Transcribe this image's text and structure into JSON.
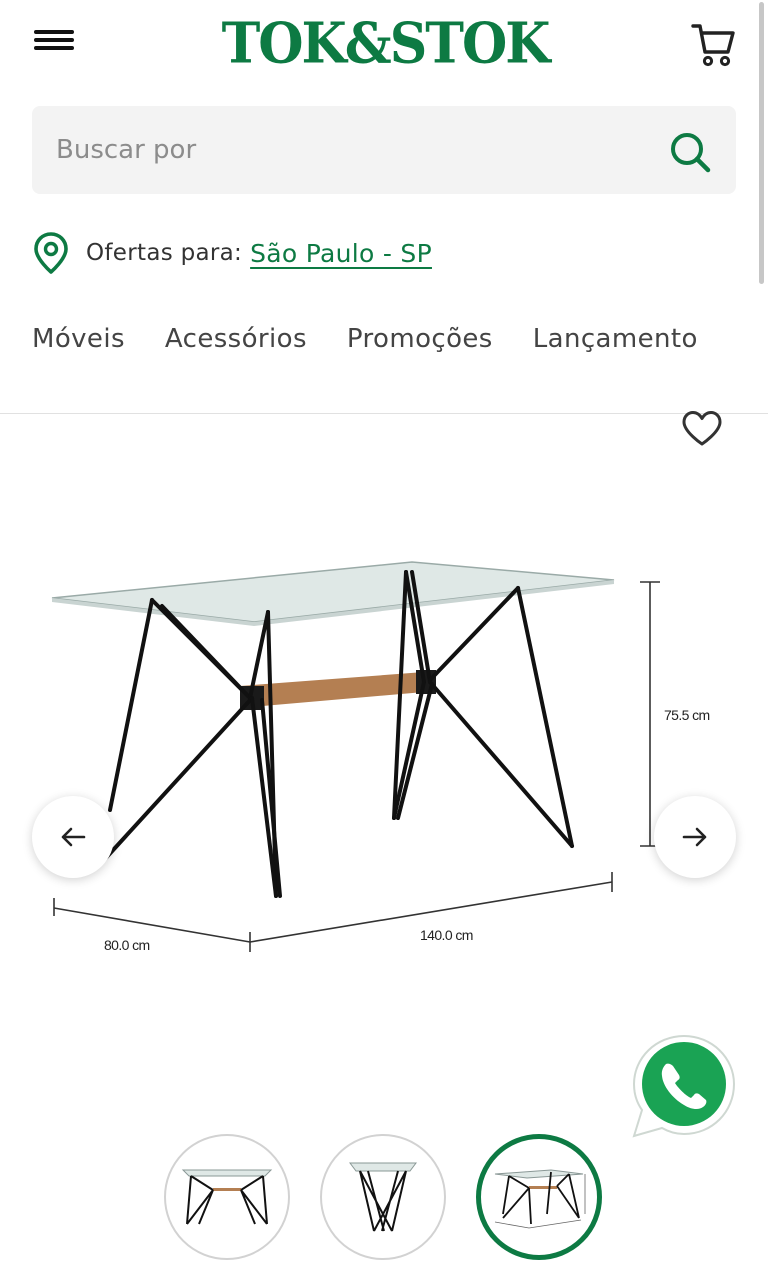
{
  "header": {
    "logo_text": "TOK&STOK",
    "brand_color": "#0d7a43",
    "menu_icon": "hamburger-menu-icon",
    "cart_icon": "shopping-cart-icon"
  },
  "search": {
    "placeholder": "Buscar por",
    "icon": "search-icon"
  },
  "location": {
    "label": "Ofertas para:",
    "city": "São Paulo - SP",
    "icon": "location-pin-icon"
  },
  "nav": {
    "items": [
      "Móveis",
      "Acessórios",
      "Promoções",
      "Lançamento"
    ]
  },
  "product": {
    "favorite_icon": "heart-outline-icon",
    "dimensions": {
      "height": "75.5 cm",
      "width": "140.0 cm",
      "depth": "80.0 cm"
    },
    "gallery": {
      "thumbnail_count": 3,
      "active_index": 3
    }
  },
  "chat": {
    "icon": "whatsapp-icon",
    "color": "#1aa354"
  }
}
